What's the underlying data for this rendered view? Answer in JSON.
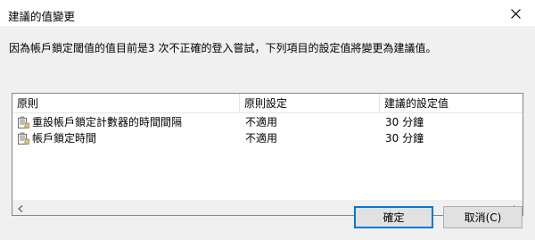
{
  "window": {
    "title": "建議的值變更"
  },
  "message": "因為帳戶鎖定閾值的值目前是3 次不正確的登入嘗試，下列項目的設定值將變更為建議值。",
  "table": {
    "columns": [
      "原則",
      "原則設定",
      "建議的設定值"
    ],
    "rows": [
      {
        "policy": "重設帳戶鎖定計數器的時間間隔",
        "setting": "不適用",
        "suggested": "30 分鐘",
        "icon": "policy-icon"
      },
      {
        "policy": "帳戶鎖定時間",
        "setting": "不適用",
        "suggested": "30 分鐘",
        "icon": "policy-icon"
      }
    ]
  },
  "buttons": {
    "ok": "確定",
    "cancel": "取消(C)"
  }
}
